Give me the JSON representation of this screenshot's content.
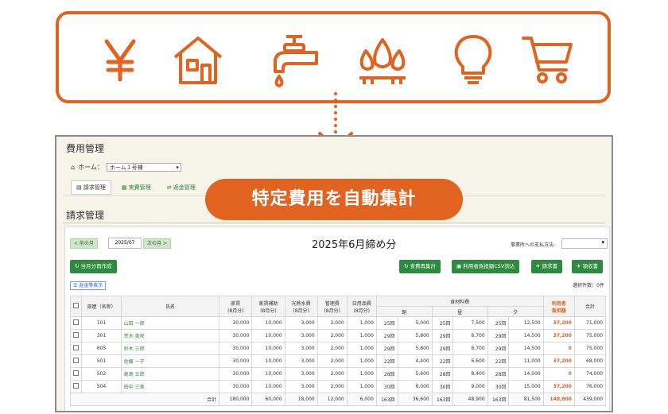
{
  "icons": [
    "yen-icon",
    "house-icon",
    "faucet-icon",
    "flame-icon",
    "lightbulb-icon",
    "cart-icon"
  ],
  "badge": "特定費用を自動集計",
  "app": {
    "title": "費用管理",
    "home_label": "ホーム：",
    "home_value": "ホーム１号棟",
    "tabs": [
      "請求管理",
      "実費管理",
      "返金管理"
    ],
    "section_title": "請求管理",
    "prev_month": "< 前の月",
    "month": "2025/07",
    "next_month": "次の月 >",
    "period": "2025年6月締め分",
    "pay_label": "事業所への支払方法:",
    "buttons": {
      "create": "当月分再作成",
      "recalc": "食費再集計",
      "csv": "利用者負担額CSV読込",
      "invoice": "請求書",
      "receipt": "領収書"
    },
    "refund_display": "返金等表示",
    "count": "選択件数：0件"
  },
  "table": {
    "headers": {
      "room": "部屋（名称）",
      "name": "氏名",
      "rent": "家賃",
      "rent_sub": "家賃補助",
      "utility": "光熱水費",
      "mgmt": "管理費",
      "daily": "日用品費",
      "unit": "(8月分)",
      "food": "食材料費",
      "breakfast": "朝",
      "lunch": "昼",
      "dinner": "夕",
      "user_cost_1": "利用者",
      "user_cost_2": "負担額",
      "total": "合計"
    },
    "rows": [
      [
        "101",
        "山田 一郎",
        "30,000",
        "10,000",
        "3,000",
        "2,000",
        "1,000",
        "25回",
        "5,000",
        "25回",
        "7,500",
        "25回",
        "12,500",
        "37,200",
        "71,000"
      ],
      [
        "301",
        "荒木 美咲",
        "30,000",
        "10,000",
        "3,000",
        "2,000",
        "1,000",
        "29回",
        "5,800",
        "29回",
        "8,700",
        "29回",
        "14,500",
        "37,200",
        "75,000"
      ],
      [
        "605",
        "鈴木 三郎",
        "30,000",
        "10,000",
        "3,000",
        "2,000",
        "1,000",
        "29回",
        "5,800",
        "29回",
        "8,700",
        "29回",
        "14,500",
        "0",
        "75,000"
      ],
      [
        "501",
        "佐藤 一子",
        "30,000",
        "10,000",
        "3,000",
        "2,000",
        "1,000",
        "22回",
        "4,400",
        "22回",
        "6,600",
        "22回",
        "11,000",
        "37,200",
        "68,000"
      ],
      [
        "502",
        "高島 五郎",
        "30,000",
        "10,000",
        "3,000",
        "2,000",
        "1,000",
        "28回",
        "5,600",
        "28回",
        "8,400",
        "28回",
        "14,000",
        "0",
        "74,000"
      ],
      [
        "504",
        "田中 三美",
        "30,000",
        "10,000",
        "3,000",
        "2,000",
        "1,000",
        "30回",
        "6,000",
        "30回",
        "9,000",
        "30回",
        "15,000",
        "37,200",
        "76,000"
      ]
    ],
    "total": [
      "合計",
      "180,000",
      "60,000",
      "18,000",
      "12,000",
      "6,000",
      "163回",
      "36,600",
      "163回",
      "48,900",
      "163回",
      "81,500",
      "148,800",
      "439,000"
    ]
  },
  "colors": {
    "accent": "#e2621f",
    "green": "#2e8a3e"
  }
}
